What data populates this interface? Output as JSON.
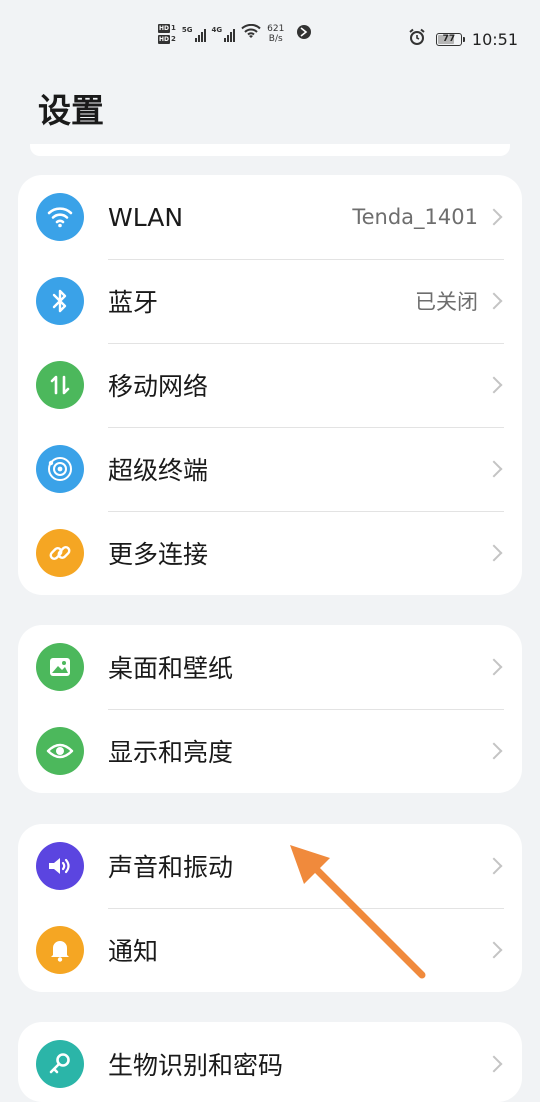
{
  "status_bar": {
    "hd1": "HD",
    "hd1_num": "1",
    "hd2": "HD",
    "hd2_num": "2",
    "sig1_label": "5G",
    "sig2_label": "4G",
    "speed_value": "621",
    "speed_unit": "B/s",
    "battery_level": "77",
    "battery_fraction": 0.77,
    "time": "10:51",
    "icons": [
      "signal-icon",
      "wifi-icon",
      "data-icon",
      "alarm-icon",
      "battery-icon"
    ]
  },
  "title": "设置",
  "groups": [
    {
      "items": [
        {
          "label": "WLAN",
          "value": "Tenda_1401",
          "icon": "wifi-icon",
          "color": "#3aa2e8"
        },
        {
          "label": "蓝牙",
          "value": "已关闭",
          "icon": "bluetooth-icon",
          "color": "#3aa2e8"
        },
        {
          "label": "移动网络",
          "value": "",
          "icon": "mobile-data-icon",
          "color": "#4cb85c"
        },
        {
          "label": "超级终端",
          "value": "",
          "icon": "super-device-icon",
          "color": "#3aa2e8"
        },
        {
          "label": "更多连接",
          "value": "",
          "icon": "link-icon",
          "color": "#f5a623"
        }
      ]
    },
    {
      "items": [
        {
          "label": "桌面和壁纸",
          "value": "",
          "icon": "wallpaper-icon",
          "color": "#4cb85c"
        },
        {
          "label": "显示和亮度",
          "value": "",
          "icon": "eye-icon",
          "color": "#4cb85c"
        }
      ]
    },
    {
      "items": [
        {
          "label": "声音和振动",
          "value": "",
          "icon": "speaker-icon",
          "color": "#5b45e0"
        },
        {
          "label": "通知",
          "value": "",
          "icon": "bell-icon",
          "color": "#f5a623"
        }
      ]
    },
    {
      "items": [
        {
          "label": "生物识别和密码",
          "value": "",
          "icon": "key-icon",
          "color": "#2bb5a8"
        }
      ]
    }
  ],
  "annotation_arrow_color": "#f08a3c"
}
